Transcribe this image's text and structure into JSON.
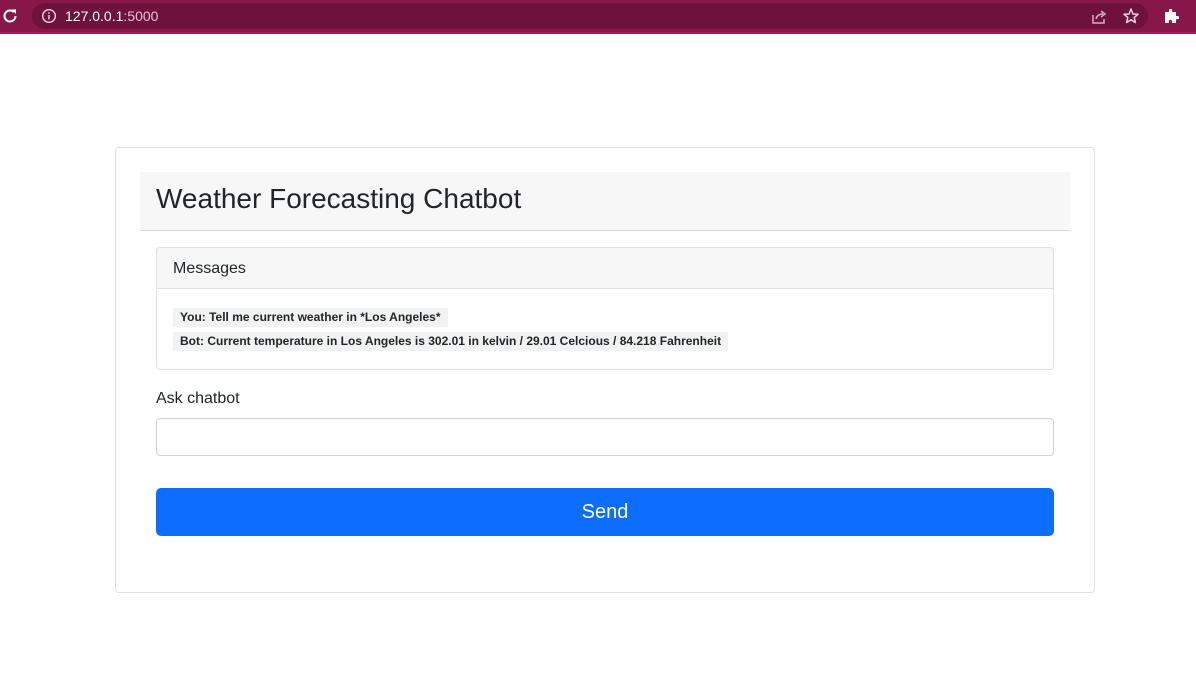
{
  "browser": {
    "url_host": "127.0.0.1",
    "url_port": ":5000"
  },
  "card": {
    "title": "Weather Forecasting Chatbot"
  },
  "messages": {
    "header": "Messages",
    "items": [
      {
        "text": "You: Tell me current weather in *Los Angeles*"
      },
      {
        "text": "Bot: Current temperature in Los Angeles is 302.01 in kelvin / 29.01 Celcious / 84.218 Fahrenheit"
      }
    ]
  },
  "form": {
    "label": "Ask chatbot",
    "input_value": "",
    "send_label": "Send"
  },
  "colors": {
    "browser_frame": "#871749",
    "button": "#0d6efd"
  }
}
